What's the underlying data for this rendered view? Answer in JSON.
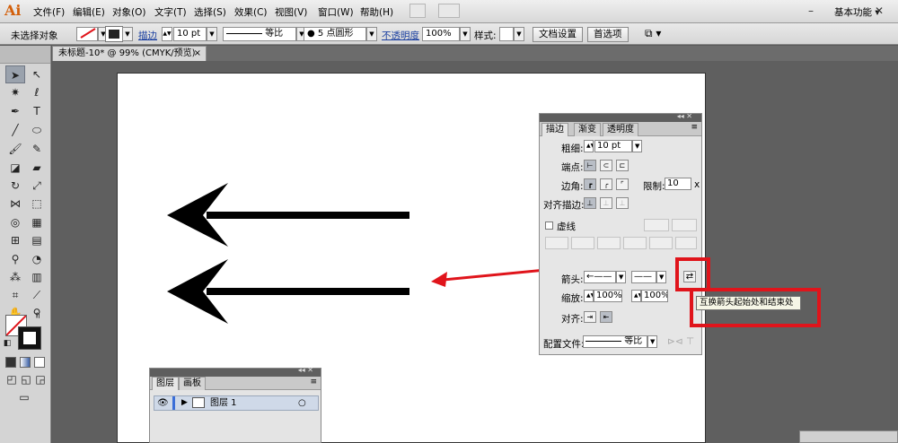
{
  "app": {
    "logo": "Ai",
    "workspace": "基本功能 ▾"
  },
  "menu": [
    "文件(F)",
    "编辑(E)",
    "对象(O)",
    "文字(T)",
    "选择(S)",
    "效果(C)",
    "视图(V)",
    "窗口(W)",
    "帮助(H)"
  ],
  "control": {
    "selection_state": "未选择对象",
    "stroke_link": "描边",
    "stroke_weight": "10 pt",
    "profile_label": "等比",
    "brush": "● 5 点圆形",
    "opacity_link": "不透明度",
    "opacity_value": "100%",
    "style_label": "样式:",
    "doc_setup_button": "文档设置",
    "prefs_button": "首选项"
  },
  "document_tab": {
    "title": "未标题-10* @ 99% (CMYK/预览)",
    "close": "×"
  },
  "stroke_panel": {
    "tabs": [
      "描边",
      "渐变",
      "透明度"
    ],
    "weight_label": "粗细:",
    "weight_value": "10 pt",
    "cap_label": "端点:",
    "corner_label": "边角:",
    "limit_label": "限制:",
    "limit_value": "10",
    "limit_unit": "x",
    "align_label": "对齐描边:",
    "dashed_label": "虚线",
    "arrow_label": "箭头:",
    "scale_label": "缩放:",
    "scale_start": "100%",
    "scale_end": "100%",
    "align2_label": "对齐:",
    "profile_label": "配置文件:",
    "profile_value": "等比",
    "swap_icon_glyph": "⇄",
    "tooltip": "互换箭头起始处和结束处"
  },
  "layers_panel": {
    "tabs": [
      "图层",
      "画板"
    ],
    "layer_name": "图层 1"
  },
  "colors": {
    "highlight_red": "#e0141b",
    "accent_orange": "#d35f0a"
  }
}
